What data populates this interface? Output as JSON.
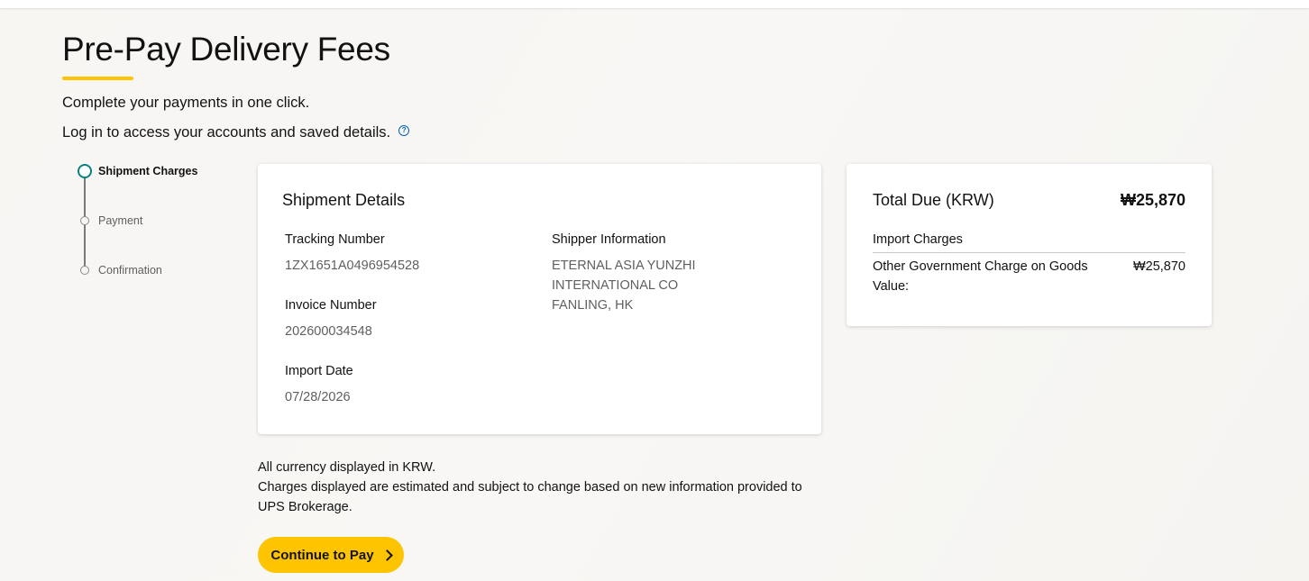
{
  "page": {
    "title": "Pre-Pay Delivery Fees",
    "intro_line1": "Complete your payments in one click.",
    "intro_line2": "Log in to access your accounts and saved details.",
    "help_icon": "question-circle-icon"
  },
  "colors": {
    "accent": "#ffc400",
    "active_step": "#0a8080",
    "link": "#0662bb"
  },
  "stepper": {
    "steps": [
      {
        "label": "Shipment Charges",
        "state": "active"
      },
      {
        "label": "Payment",
        "state": "pending"
      },
      {
        "label": "Confirmation",
        "state": "pending"
      }
    ]
  },
  "shipment_details": {
    "title": "Shipment Details",
    "tracking_label": "Tracking Number",
    "tracking_value": "1ZX1651A0496954528",
    "invoice_label": "Invoice Number",
    "invoice_value": "202600034548",
    "import_date_label": "Import Date",
    "import_date_value": "07/28/2026",
    "shipper_label": "Shipper Information",
    "shipper_name": "ETERNAL ASIA YUNZHI INTERNATIONAL CO",
    "shipper_location": "FANLING, HK"
  },
  "total_due": {
    "title": "Total Due (KRW)",
    "amount": "₩25,870",
    "section_label": "Import Charges",
    "charge_label": "Other Government Charge on Goods Value:",
    "charge_value": "₩25,870"
  },
  "disclaimer": {
    "line1": "All currency displayed in KRW.",
    "line2": "Charges displayed are estimated and subject to change based on new information provided to UPS Brokerage."
  },
  "cta": {
    "label": "Continue to Pay",
    "icon": "chevron-right-icon"
  }
}
